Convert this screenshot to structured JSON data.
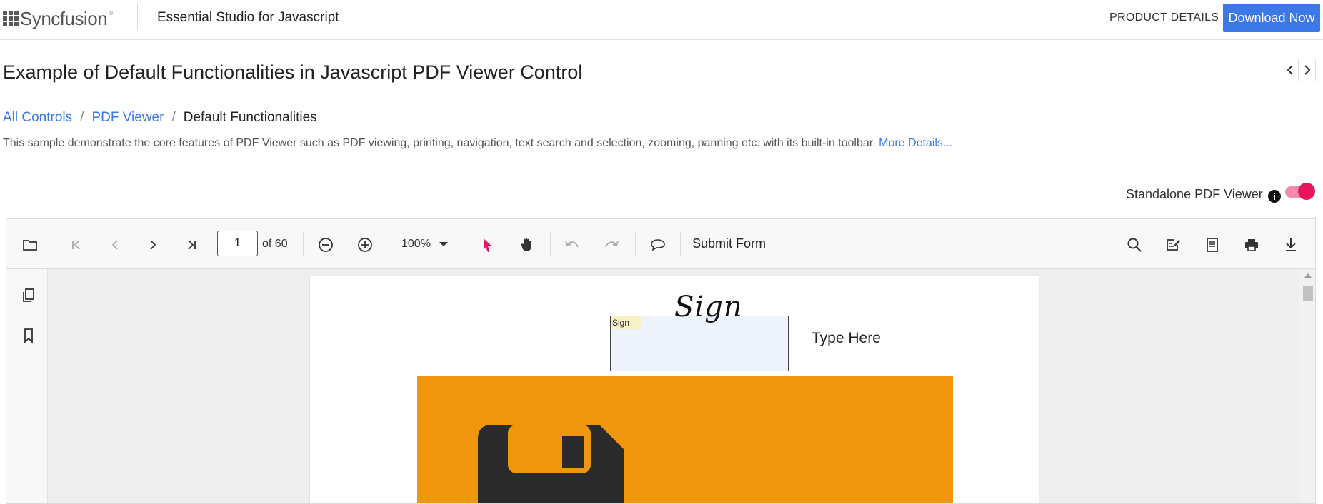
{
  "header": {
    "logo_text": "Syncfusion",
    "logo_tm": "®",
    "product_title": "Essential Studio for Javascript",
    "product_details_label": "PRODUCT DETAILS",
    "download_label": "Download Now"
  },
  "page": {
    "title": "Example of Default Functionalities in Javascript PDF Viewer Control",
    "breadcrumb": [
      {
        "label": "All Controls"
      },
      {
        "label": "PDF Viewer"
      },
      {
        "label": "Default Functionalities"
      }
    ],
    "breadcrumb_separator": "/",
    "description": "This sample demonstrate the core features of PDF Viewer such as PDF viewing, printing, navigation, text search and selection, zooming, panning etc. with its built-in toolbar.",
    "more_details_label": "More Details...",
    "standalone_label": "Standalone PDF Viewer",
    "standalone_enabled": true
  },
  "toolbar": {
    "current_page": "1",
    "page_of": "of 60",
    "zoom_level": "100%",
    "submit_form_label": "Submit Form",
    "icons": [
      "open-folder-icon",
      "first-page-icon",
      "previous-page-icon",
      "next-page-icon",
      "last-page-icon",
      "zoom-out-icon",
      "zoom-in-icon",
      "selection-cursor-icon",
      "pan-hand-icon",
      "undo-icon",
      "redo-icon",
      "comment-icon",
      "search-icon",
      "edit-annotation-icon",
      "form-fields-icon",
      "print-icon",
      "download-icon"
    ]
  },
  "side_panel": {
    "icons": [
      "page-thumbnails-icon",
      "bookmark-icon"
    ]
  },
  "document": {
    "sign_field_label": "Sign",
    "signature_text": "Sign",
    "type_here_text": "Type Here"
  },
  "colors": {
    "accent_blue": "#3c79e6",
    "toggle_pink": "#e8175d",
    "orange": "#f0960d",
    "selection_cursor": "#e8175d"
  }
}
